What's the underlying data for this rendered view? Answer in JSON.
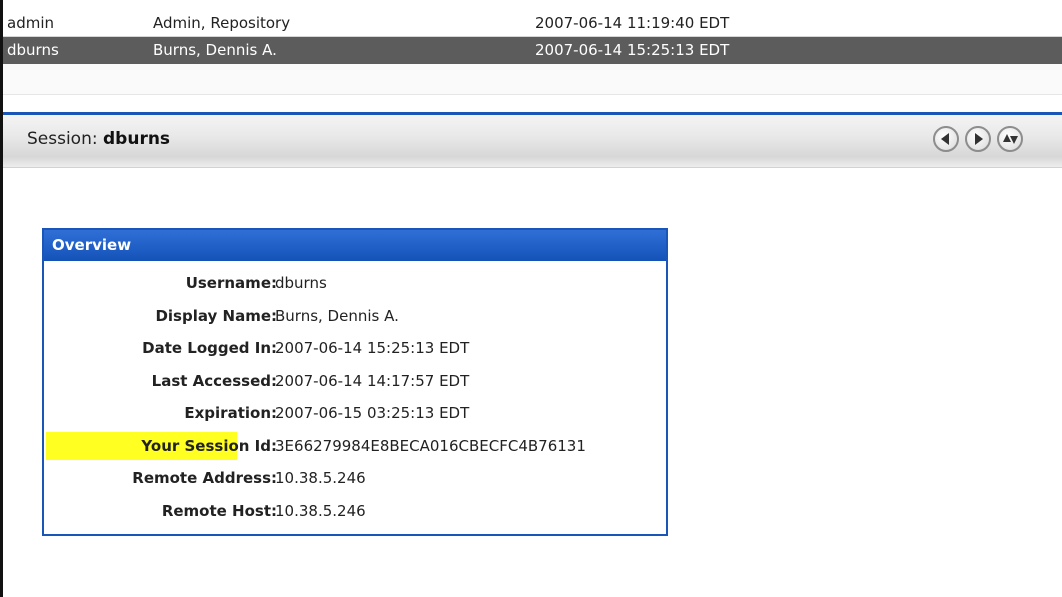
{
  "sessions": [
    {
      "username": "admin",
      "display_name": "Admin, Repository",
      "date": "2007-06-14 11:19:40 EDT",
      "selected": false
    },
    {
      "username": "dburns",
      "display_name": "Burns, Dennis A.",
      "date": "2007-06-14 15:25:13 EDT",
      "selected": true
    }
  ],
  "session_header": {
    "prefix": "Session: ",
    "name": "dburns",
    "prev_icon": "arrow-left-icon",
    "next_icon": "arrow-right-icon",
    "updown_icon": "arrow-up-down-icon"
  },
  "overview": {
    "title": "Overview",
    "fields": [
      {
        "label": "Username:",
        "value": "dburns"
      },
      {
        "label": "Display Name:",
        "value": "Burns, Dennis A."
      },
      {
        "label": "Date Logged In:",
        "value": "2007-06-14 15:25:13 EDT"
      },
      {
        "label": "Last Accessed:",
        "value": "2007-06-14 14:17:57 EDT"
      },
      {
        "label": "Expiration:",
        "value": "2007-06-15 03:25:13 EDT"
      },
      {
        "label": "Your Session Id:",
        "value": "3E66279984E8BECA016CBECFC4B76131",
        "highlighted": true
      },
      {
        "label": "Remote Address:",
        "value": "10.38.5.246"
      },
      {
        "label": "Remote Host:",
        "value": "10.38.5.246"
      }
    ]
  },
  "colors": {
    "accent_blue": "#1a56b8",
    "selected_row": "#5c5c5c",
    "highlight": "#ffff22"
  }
}
